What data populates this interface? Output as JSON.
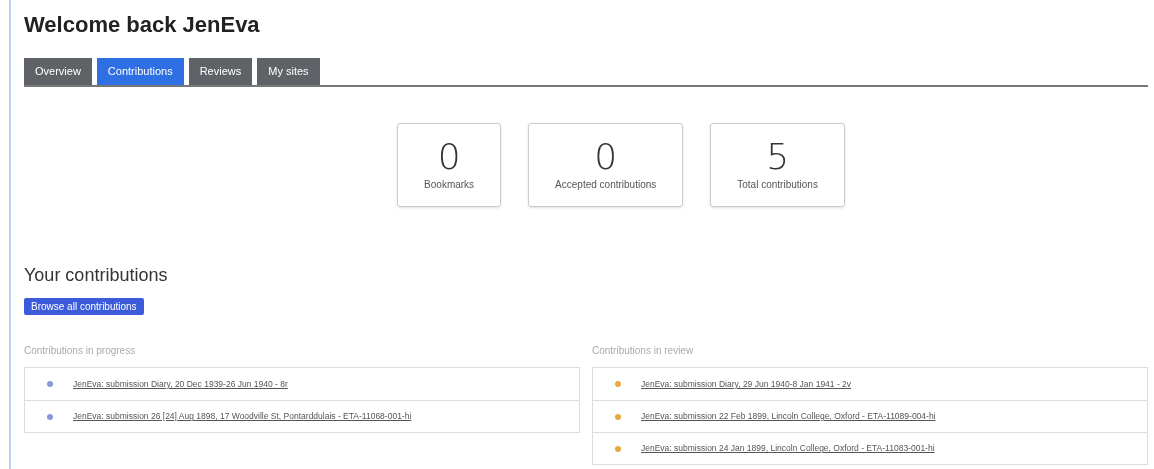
{
  "title": "Welcome back JenEva",
  "tabs": [
    {
      "label": "Overview",
      "selected": false
    },
    {
      "label": "Contributions",
      "selected": true
    },
    {
      "label": "Reviews",
      "selected": false
    },
    {
      "label": "My sites",
      "selected": false
    }
  ],
  "stats": [
    {
      "value": "0",
      "label": "Bookmarks"
    },
    {
      "value": "0",
      "label": "Accepted contributions"
    },
    {
      "value": "5",
      "label": "Total contributions"
    }
  ],
  "contributions": {
    "heading": "Your contributions",
    "button": "Browse all contributions",
    "lists": [
      {
        "heading": "Contributions in progress",
        "items": [
          {
            "text": "JenEva: submission Diary, 20 Dec 1939-26 Jun 1940 - 8r",
            "color": "#8a98d8"
          },
          {
            "text": "JenEva: submission 26 [24] Aug 1898, 17 Woodville St, Pontarddulais - ETA-11068-001-hi",
            "color": "#8a98d8"
          }
        ]
      },
      {
        "heading": "Contributions in review",
        "items": [
          {
            "text": "JenEva: submission Diary, 29 Jun 1940-8 Jan 1941 - 2v",
            "color": "#e8a840"
          },
          {
            "text": "JenEva: submission 22 Feb 1899, Lincoln College, Oxford - ETA-11089-004-hi",
            "color": "#e8a840"
          },
          {
            "text": "JenEva: submission 24 Jan 1899, Lincoln College, Oxford - ETA-11083-001-hi",
            "color": "#e8a840"
          }
        ]
      }
    ]
  }
}
